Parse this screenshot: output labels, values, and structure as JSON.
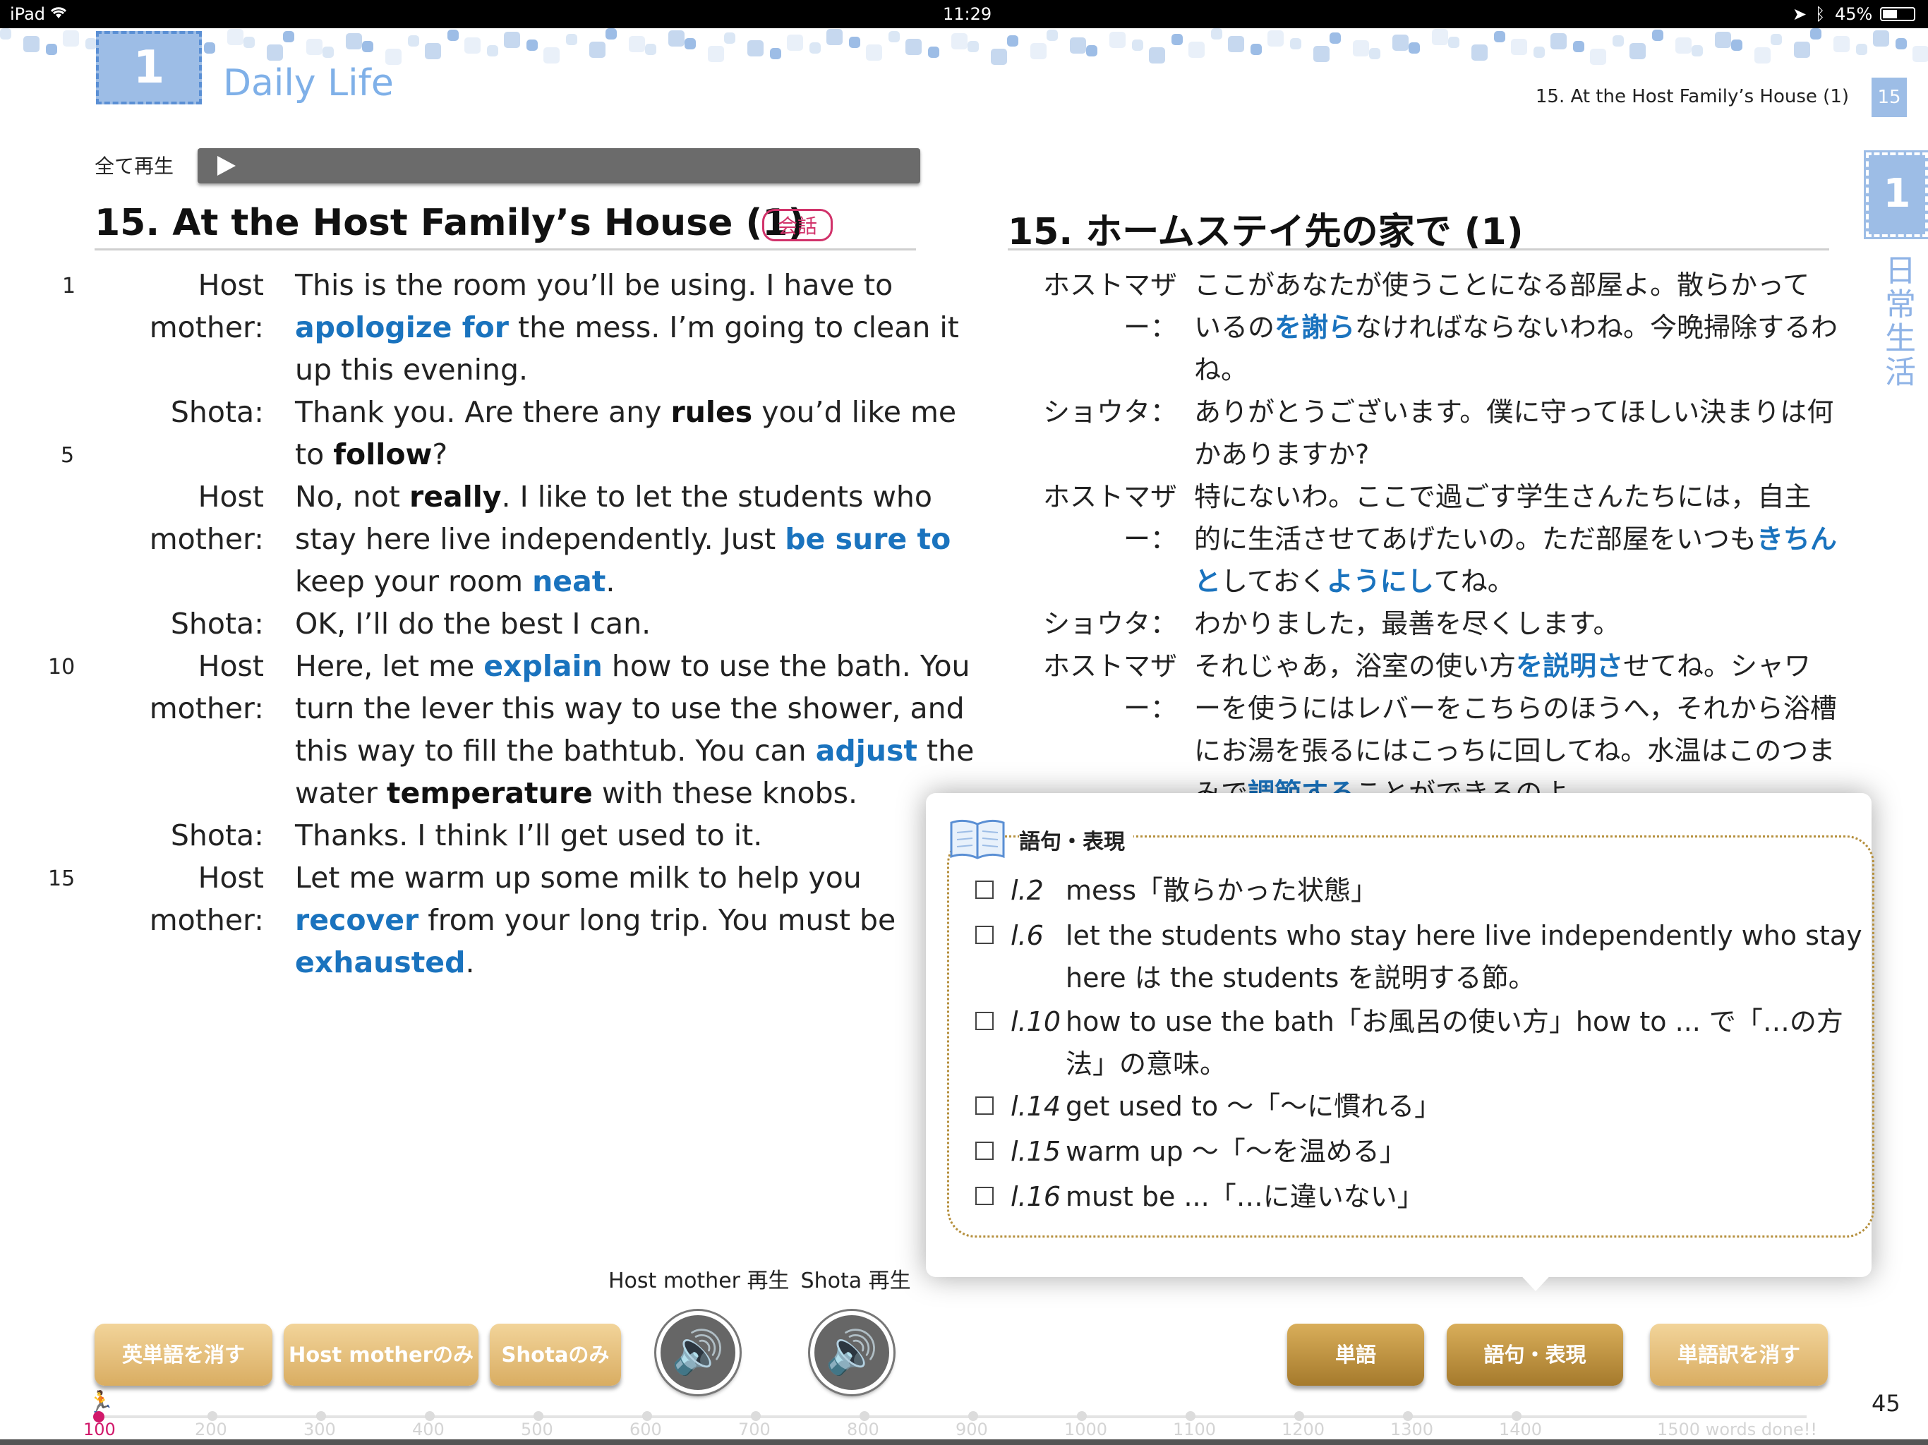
{
  "status_bar": {
    "device": "iPad",
    "time": "11:29",
    "battery": "45%"
  },
  "header": {
    "chapter_number": "1",
    "chapter_title": "Daily Life",
    "right_title": "15. At the Host Family’s House (1)",
    "page_badge": "15",
    "side_badge": "1",
    "side_label": "日常生活"
  },
  "play_all": {
    "label": "全て再生"
  },
  "english": {
    "title": "15. At the Host Family’s House (1)",
    "tag": "会話",
    "line_numbers": [
      "1",
      "5",
      "10",
      "15"
    ],
    "speakers": {
      "host": "Host mother:",
      "shota": "Shota:"
    },
    "lines": [
      [
        "This is the room you’ll be using. I have to"
      ],
      [
        "apologize for",
        " the mess. I’m going to clean it"
      ],
      [
        "up this evening."
      ],
      [
        "Thank you. Are there any ",
        "rules",
        " you’d like me"
      ],
      [
        "to ",
        "follow",
        "?"
      ],
      [
        "No, not ",
        "really",
        ". I like to let the students who"
      ],
      [
        "stay here live independently. Just ",
        "be sure to"
      ],
      [
        "keep your room ",
        "neat",
        "."
      ],
      [
        "OK, I’ll do the best I can."
      ],
      [
        "Here, let me ",
        "explain",
        " how to use the bath. You"
      ],
      [
        "turn the lever this way to use the shower, and"
      ],
      [
        "this way to fill the bathtub. You can ",
        "adjust",
        " the"
      ],
      [
        "water ",
        "temperature",
        " with these knobs."
      ],
      [
        "Thanks. I think I’ll get used to it."
      ],
      [
        "Let me warm up some milk to help you"
      ],
      [
        "recover",
        " from your long trip. You must be"
      ],
      [
        "exhausted",
        "."
      ]
    ]
  },
  "japanese": {
    "title": "15. ホームステイ先の家で (1)",
    "speakers": {
      "host": "ホストマザー：",
      "shota": "ショウタ："
    },
    "lines": [
      [
        "ここがあなたが使うことになる部屋よ。散らかって"
      ],
      [
        "いるの",
        "を謝ら",
        "なければならないわね。今晩掃除するわ"
      ],
      [
        "ね。"
      ],
      [
        "ありがとうございます。僕に守ってほしい決まりは何"
      ],
      [
        "かありますか?"
      ],
      [
        "特にないわ。ここで過ごす学生さんたちには，自主"
      ],
      [
        "的に生活させてあげたいの。ただ部屋をいつも",
        "きちん"
      ],
      [
        "と",
        "しておく",
        "ようにし",
        "てね。"
      ],
      [
        "わかりました，最善を尽くします。"
      ],
      [
        "それじゃあ，浴室の使い方",
        "を説明さ",
        "せてね。シャワ"
      ],
      [
        "ーを使うにはレバーをこちらのほうへ，それから浴槽"
      ],
      [
        "にお湯を張るにはこっちに回してね。水温はこのつま"
      ],
      [
        "みで",
        "調節する",
        "ことができるのよ。"
      ]
    ]
  },
  "glossary": {
    "heading": "語句・表現",
    "items": [
      {
        "ref": "l.2",
        "text": "mess「散らかった状態」"
      },
      {
        "ref": "l.6",
        "text": "let the students who stay here live independently who stay here は the students を説明する節。"
      },
      {
        "ref": "l.10",
        "text": "how to use the bath「お風呂の使い方」how to ... で「…の方法」の意味。"
      },
      {
        "ref": "l.14",
        "text": "get used to 〜「〜に慣れる」"
      },
      {
        "ref": "l.15",
        "text": "warm up 〜「〜を温める」"
      },
      {
        "ref": "l.16",
        "text": "must be ...「…に違いない」"
      }
    ]
  },
  "controls": {
    "hide_words": "英単語を消す",
    "host_only": "Host motherのみ",
    "shota_only": "Shotaのみ",
    "host_play": "Host mother 再生",
    "shota_play": "Shota 再生",
    "words": "単語",
    "phrases": "語句・表現",
    "hide_translation": "単語訳を消す"
  },
  "progress": {
    "current": "100",
    "ticks": [
      "200",
      "300",
      "400",
      "500",
      "600",
      "700",
      "800",
      "900",
      "1000",
      "1100",
      "1200",
      "1300",
      "1400"
    ],
    "done_label": "1500 words done!!"
  },
  "page_number": "45",
  "colors": {
    "accent_blue": "#1a73be",
    "chapter_blue": "#9dbde6",
    "gold": "#c99d4e",
    "tag_pink": "#d1326a"
  }
}
